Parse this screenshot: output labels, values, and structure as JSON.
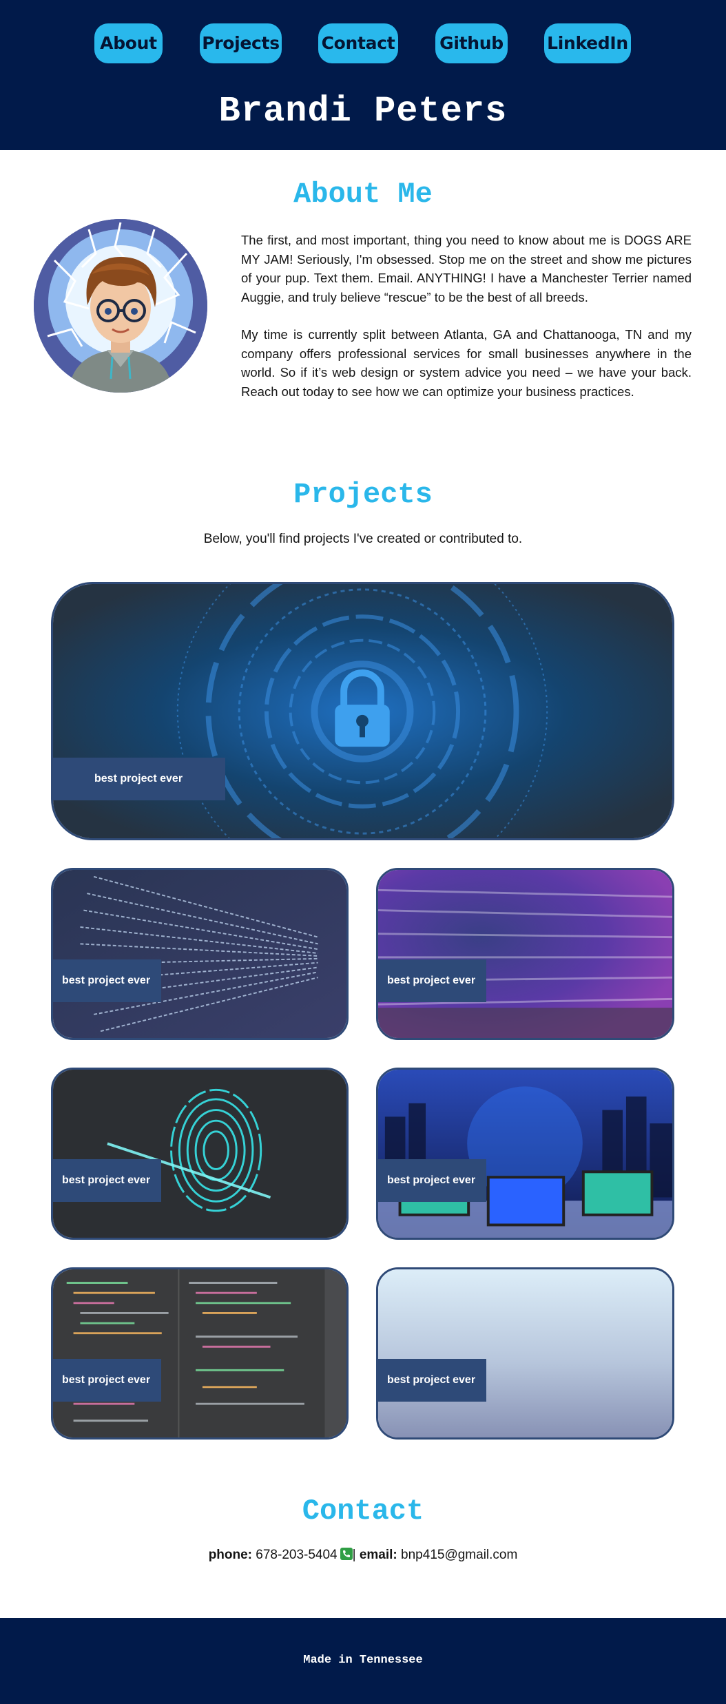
{
  "nav": {
    "items": [
      {
        "label": "About"
      },
      {
        "label": "Projects"
      },
      {
        "label": "Contact"
      },
      {
        "label": "Github"
      },
      {
        "label": "LinkedIn"
      }
    ]
  },
  "header": {
    "name": "Brandi Peters"
  },
  "about": {
    "title": "About Me",
    "paragraphs": [
      "The first, and most important, thing you need to know about me is DOGS ARE MY JAM! Seriously, I'm obsessed. Stop me on the street and show me pictures of your pup. Text them. Email. ANYTHING! I have a Manchester Terrier named Auggie, and truly believe “rescue” to be the best of all breeds.",
      "My time is currently split between Atlanta, GA and Chattanooga, TN and my company offers professional services for small businesses anywhere in the world. So if it’s web design or system advice you need – we have your back. Reach out today to see how we can optimize your business practices."
    ]
  },
  "projects": {
    "title": "Projects",
    "intro": "Below, you'll find projects I've created or contributed to.",
    "cards": [
      {
        "label": "best project ever",
        "image": "padlock-cyber-image"
      },
      {
        "label": "best project ever",
        "image": "data-stream-image"
      },
      {
        "label": "best project ever",
        "image": "purple-code-image"
      },
      {
        "label": "best project ever",
        "image": "fingerprint-image"
      },
      {
        "label": "best project ever",
        "image": "city-monitors-image"
      },
      {
        "label": "best project ever",
        "image": "code-editor-image"
      },
      {
        "label": "best project ever",
        "image": "gradient-image"
      }
    ]
  },
  "contact": {
    "title": "Contact",
    "phone_label": "phone:",
    "phone": "678-203-5404",
    "separator": "|",
    "email_label": "email:",
    "email": "bnp415@gmail.com"
  },
  "footer": {
    "text": "Made in Tennessee"
  },
  "colors": {
    "navy": "#011a4a",
    "accent": "#29b8ec",
    "card_border": "#2f4a77",
    "label_bg": "#2e4a78"
  }
}
